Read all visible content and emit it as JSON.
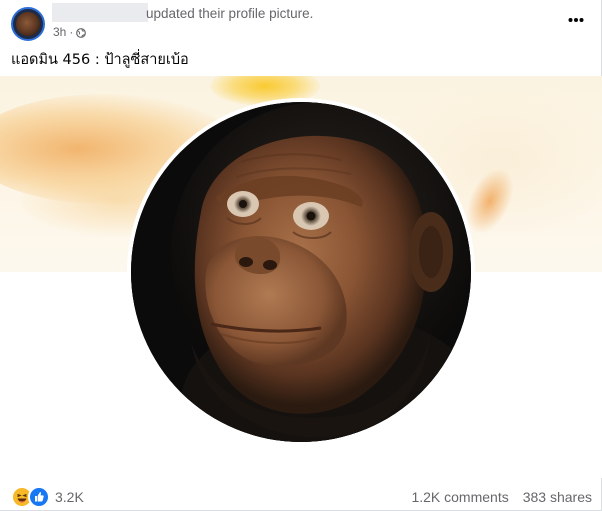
{
  "post": {
    "author_name": "",
    "action": "updated their profile picture.",
    "timestamp": "3h",
    "audience_icon": "globe-icon",
    "more_icon": "more-options-icon",
    "caption": "แอดมิน 456 : ป้าลูซี่สายเบ้อ"
  },
  "media": {
    "cover_description": "",
    "profile_photo": "hominin-face"
  },
  "footer": {
    "reaction_icons": [
      "haha-icon",
      "like-icon"
    ],
    "reaction_count": "3.2K",
    "comments": "1.2K comments",
    "shares": "383 shares"
  },
  "colors": {
    "secondary_text": "#65676b",
    "like_blue": "#1877f2",
    "haha_yellow": "#f7b928"
  }
}
